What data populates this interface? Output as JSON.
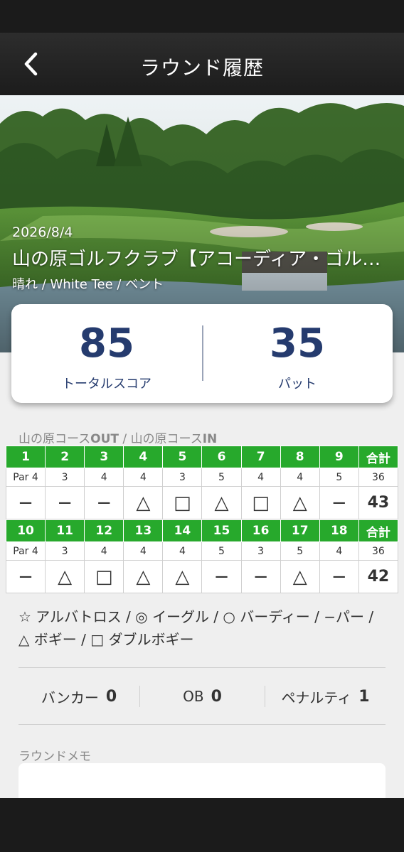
{
  "header": {
    "title": "ラウンド履歴"
  },
  "hero": {
    "date": "2026/8/4",
    "course_name": "山の原ゴルフクラブ【アコーディア・ゴルフ】",
    "conditions": "晴れ / White Tee / ベント"
  },
  "summary": {
    "total_score": "85",
    "total_score_label": "トータルスコア",
    "putts": "35",
    "putts_label": "パット"
  },
  "scorecard": {
    "course_label_prefix": "山の原コース",
    "course_out": "OUT",
    "separator": " / ",
    "course_label_prefix2": "山の原コース",
    "course_in": "IN",
    "total_label": "合計",
    "front": {
      "holes": [
        "1",
        "2",
        "3",
        "4",
        "5",
        "6",
        "7",
        "8",
        "9"
      ],
      "pars": [
        "Par 4",
        "3",
        "4",
        "4",
        "3",
        "5",
        "4",
        "4",
        "5"
      ],
      "par_total": "36",
      "results": [
        "−",
        "−",
        "−",
        "△",
        "□",
        "△",
        "□",
        "△",
        "−"
      ],
      "score_total": "43"
    },
    "back": {
      "holes": [
        "10",
        "11",
        "12",
        "13",
        "14",
        "15",
        "16",
        "17",
        "18"
      ],
      "pars": [
        "Par 4",
        "3",
        "4",
        "4",
        "4",
        "5",
        "3",
        "5",
        "4"
      ],
      "par_total": "36",
      "results": [
        "−",
        "△",
        "□",
        "△",
        "△",
        "−",
        "−",
        "△",
        "−"
      ],
      "score_total": "42"
    }
  },
  "legend": "☆ アルバトロス / ◎ イーグル / ○ バーディー / −パー / △ ボギー / □ ダブルボギー",
  "stats": {
    "bunker_label": "バンカー",
    "bunker_value": "0",
    "ob_label": "OB",
    "ob_value": "0",
    "penalty_label": "ペナルティ",
    "penalty_value": "1"
  },
  "memo": {
    "label": "ラウンドメモ"
  },
  "colors": {
    "hole_header_green": "#27a92c",
    "score_navy": "#253b6e",
    "app_bar": "#1c1c1c"
  }
}
